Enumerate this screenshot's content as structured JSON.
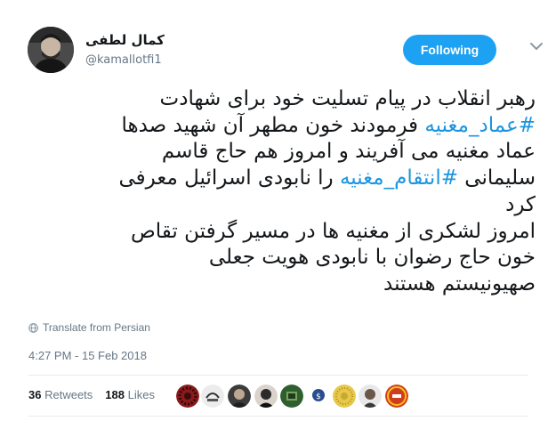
{
  "tweet": {
    "display_name": "کمال لطفی",
    "username": "@kamallotfi1",
    "follow_label": "Following",
    "lines": [
      [
        {
          "t": "رهبر انقلاب در پیام تسلیت خود برای شهادت"
        }
      ],
      [
        {
          "t": "#عماد_مغنیه",
          "tag": true
        },
        {
          "t": " فرمودند خون مطهر آن شهید صدها"
        }
      ],
      [
        {
          "t": "عماد مغنیه می آفریند و امروز هم حاج قاسم"
        }
      ],
      [
        {
          "t": "سلیمانی "
        },
        {
          "t": "#انتقام_مغنیه",
          "tag": true
        },
        {
          "t": " را نابودی اسرائیل معرفی"
        }
      ],
      [
        {
          "t": "کرد"
        }
      ],
      [
        {
          "t": "امروز لشکری از مغنیه ها در مسیر گرفتن تقاص"
        }
      ],
      [
        {
          "t": "خون حاج رضوان با نابودی هویت جعلی"
        }
      ],
      [
        {
          "t": "صهیونیستم هستند"
        }
      ]
    ],
    "translate_label": "Translate from Persian",
    "timestamp": "4:27 PM - 15 Feb 2018",
    "retweets_count": "36",
    "retweets_label": "Retweets",
    "likes_count": "188",
    "likes_label": "Likes"
  },
  "colors": {
    "accent": "#1da1f2",
    "hashtag": "#1b95e0",
    "muted": "#657786",
    "text": "#14171a"
  },
  "icons": {
    "caret": "chevron-down-icon",
    "translate": "globe-icon"
  }
}
